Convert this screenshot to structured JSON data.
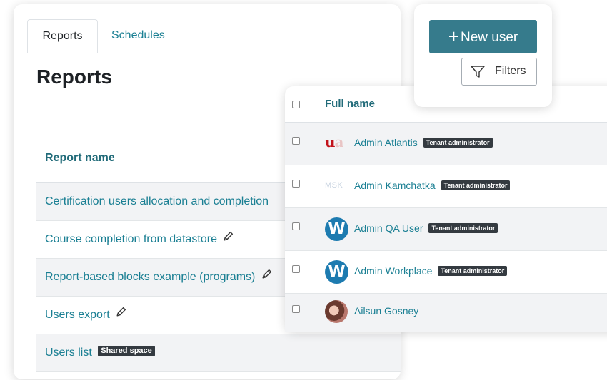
{
  "reports_panel": {
    "tabs": [
      {
        "label": "Reports",
        "active": true
      },
      {
        "label": "Schedules",
        "active": false
      }
    ],
    "title": "Reports",
    "column_header": "Report name",
    "rows": [
      {
        "name": "Certification users allocation and completion",
        "editable": false,
        "badge": ""
      },
      {
        "name": "Course completion from datastore",
        "editable": true,
        "badge": ""
      },
      {
        "name": "Report-based blocks example (programs)",
        "editable": true,
        "badge": ""
      },
      {
        "name": "Users export",
        "editable": true,
        "badge": ""
      },
      {
        "name": "Users list",
        "editable": false,
        "badge": "Shared space"
      }
    ]
  },
  "users_panel": {
    "column_header": "Full name",
    "rows": [
      {
        "name": "Admin Atlantis",
        "badge": "Tenant administrator",
        "icon": "ua-logo"
      },
      {
        "name": "Admin Kamchatka",
        "badge": "Tenant administrator",
        "icon": "msk-logo"
      },
      {
        "name": "Admin QA User",
        "badge": "Tenant administrator",
        "icon": "workplace-w-logo"
      },
      {
        "name": "Admin Workplace",
        "badge": "Tenant administrator",
        "icon": "workplace-w-logo"
      },
      {
        "name": "Ailsun Gosney",
        "badge": "",
        "icon": "user-avatar"
      }
    ],
    "logos": {
      "ua": [
        "u",
        "a"
      ],
      "msk": "MSK",
      "w": "W"
    }
  },
  "actions": {
    "new_user_icon": "+",
    "new_user_label": "New user",
    "filters_label": "Filters"
  },
  "colors": {
    "link": "#1a7f93",
    "header": "#216b79",
    "primary_button": "#367b8c",
    "badge": "#343a40",
    "stripe": "#f2f3f5"
  }
}
